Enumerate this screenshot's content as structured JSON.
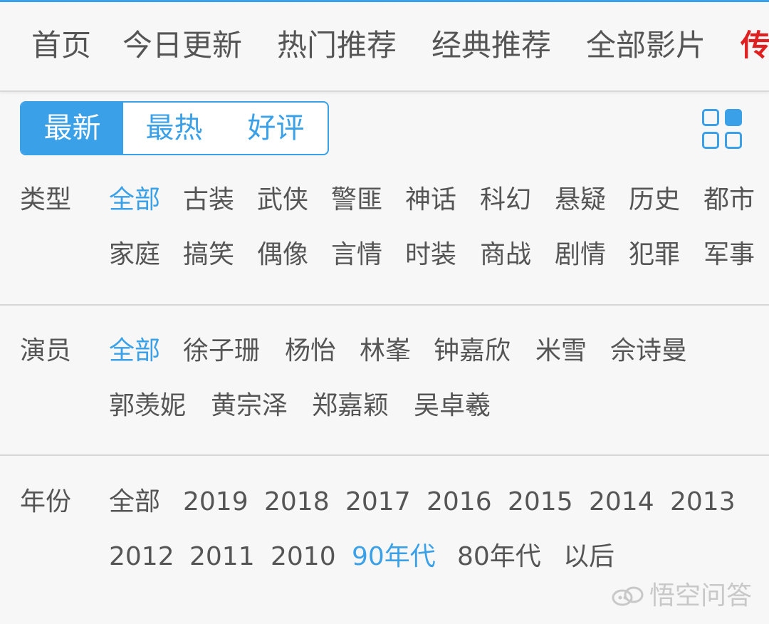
{
  "nav": {
    "items": [
      "首页",
      "今日更新",
      "热门推荐",
      "经典推荐",
      "全部影片",
      "传"
    ]
  },
  "sort": {
    "tabs": [
      "最新",
      "最热",
      "好评"
    ],
    "active": "最新"
  },
  "view_toggle": {
    "icon": "grid-view-icon"
  },
  "filters": {
    "type": {
      "label": "类型",
      "row1": [
        "全部",
        "古装",
        "武侠",
        "警匪",
        "神话",
        "科幻",
        "悬疑",
        "历史",
        "都市"
      ],
      "row2": [
        "家庭",
        "搞笑",
        "偶像",
        "言情",
        "时装",
        "商战",
        "剧情",
        "犯罪",
        "军事"
      ],
      "selected": "全部"
    },
    "actor": {
      "label": "演员",
      "row1": [
        "全部",
        "徐子珊",
        "杨怡",
        "林峯",
        "钟嘉欣",
        "米雪",
        "佘诗曼"
      ],
      "row2": [
        "郭羡妮",
        "黄宗泽",
        "郑嘉颖",
        "吴卓羲"
      ],
      "selected": "全部"
    },
    "year": {
      "label": "年份",
      "row1": [
        "全部",
        "2019",
        "2018",
        "2017",
        "2016",
        "2015",
        "2014",
        "2013"
      ],
      "row2": [
        "2012",
        "2011",
        "2010",
        "90年代",
        "80年代",
        "以后"
      ],
      "selected": "90年代"
    }
  },
  "watermark": {
    "text": "悟空问答"
  },
  "colors": {
    "accent": "#3aa0e8",
    "text": "#555555",
    "hot": "#e02020",
    "background": "#f7f7f7"
  }
}
